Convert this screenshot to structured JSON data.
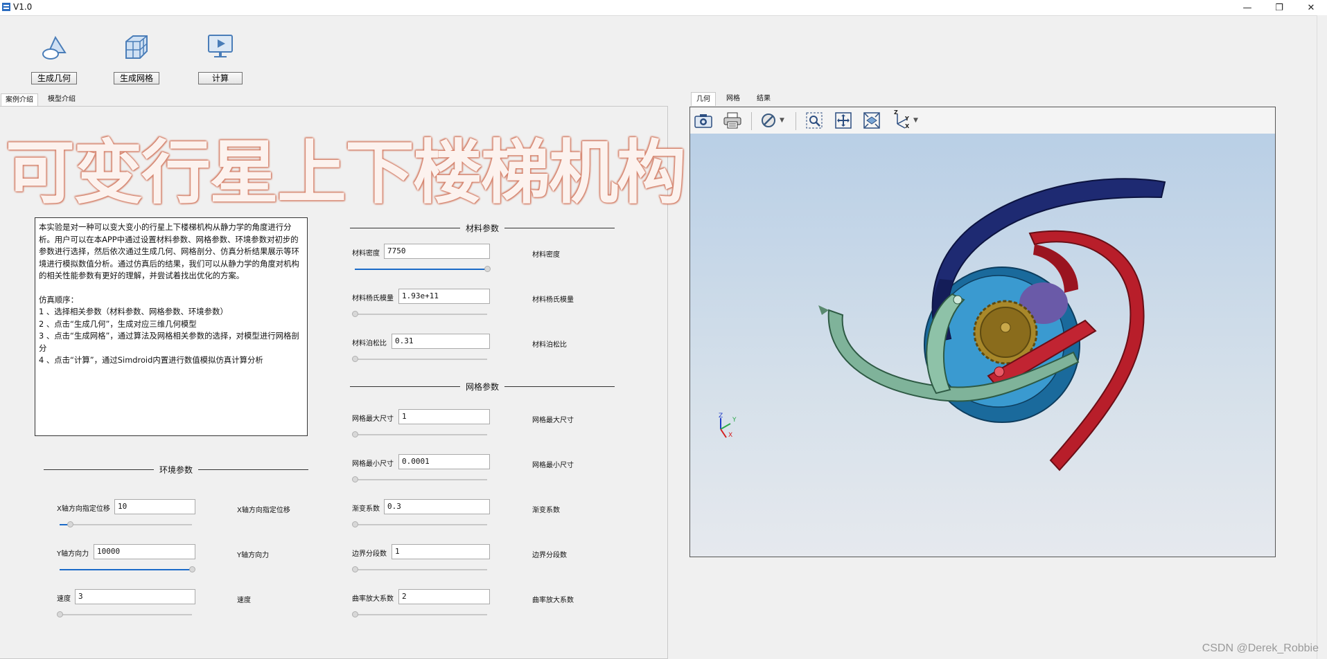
{
  "window": {
    "title": "V1.0",
    "minimize": "—",
    "maximize": "❐",
    "close": "✕"
  },
  "toolbar": {
    "geometry_label": "生成几何",
    "mesh_label": "生成网格",
    "compute_label": "计算"
  },
  "left_tabs": [
    "案例介绍",
    "模型介绍"
  ],
  "big_title": "可变行星上下楼梯机构",
  "description": {
    "paragraph": "本实验是对一种可以变大变小的行星上下楼梯机构从静力学的角度进行分析。用户可以在本APP中通过设置材料参数、网格参数、环境参数对初步的参数进行选择，然后依次通过生成几何、网格剖分、仿真分析结果展示等环境进行模拟数值分析。通过仿真后的结果，我们可以从静力学的角度对机构的相关性能参数有更好的理解，并尝试着找出优化的方案。",
    "steps_title": "仿真顺序：",
    "steps": [
      "1 、选择相关参数（材料参数、网格参数、环境参数）",
      "2 、点击“生成几何”，生成对应三维几何模型",
      "3 、点击“生成网格”，通过算法及网格相关参数的选择，对模型进行网格剖分",
      "4 、点击“计算”，通过Simdroid内置进行数值模拟仿真计算分析"
    ]
  },
  "env_section": {
    "title": "环境参数",
    "params": [
      {
        "label": "X轴方向指定位移",
        "value": "10",
        "right_label": "X轴方向指定位移",
        "slider": 0.08
      },
      {
        "label": "Y轴方向力",
        "value": "10000",
        "right_label": "Y轴方向力",
        "slider": 1.0
      },
      {
        "label": "速度",
        "value": "3",
        "right_label": "速度",
        "slider": 0.0
      }
    ]
  },
  "material_section": {
    "title": "材料参数",
    "params": [
      {
        "label": "材料密度",
        "value": "7750",
        "right_label": "材料密度",
        "slider": 1.0
      },
      {
        "label": "材料杨氏模量",
        "value": "1.93e+11",
        "right_label": "材料杨氏模量",
        "slider": 0.0
      },
      {
        "label": "材料泊松比",
        "value": "0.31",
        "right_label": "材料泊松比",
        "slider": 0.0
      }
    ]
  },
  "mesh_section": {
    "title": "网格参数",
    "params": [
      {
        "label": "网格最大尺寸",
        "value": "1",
        "right_label": "网格最大尺寸",
        "slider": 0.0
      },
      {
        "label": "网格最小尺寸",
        "value": "0.0001",
        "right_label": "网格最小尺寸",
        "slider": 0.0
      },
      {
        "label": "渐变系数",
        "value": "0.3",
        "right_label": "渐变系数",
        "slider": 0.0
      },
      {
        "label": "边界分段数",
        "value": "1",
        "right_label": "边界分段数",
        "slider": 0.0
      },
      {
        "label": "曲率放大系数",
        "value": "2",
        "right_label": "曲率放大系数",
        "slider": 0.0
      }
    ]
  },
  "right_tabs": [
    "几何",
    "网格",
    "结果"
  ],
  "axes": {
    "z": "Z",
    "y": "Y",
    "x": "X"
  },
  "view_axes": {
    "z": "Z",
    "y": "Y",
    "x": "X"
  },
  "watermark": "CSDN @Derek_Robbie",
  "colors": {
    "accent": "#1a6ac8",
    "navy": "#1c2a6a",
    "red": "#b81e2a",
    "teal": "#7fb39a",
    "title_glow": "#d9826a"
  }
}
